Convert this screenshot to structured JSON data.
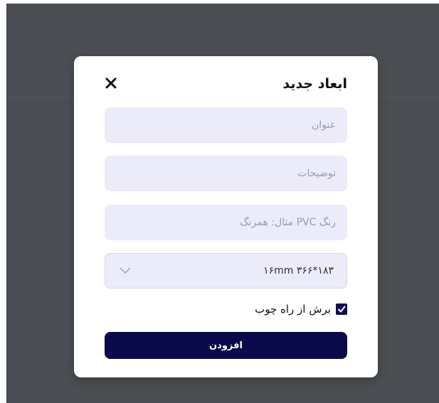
{
  "modal": {
    "title": "ابعاد جدید",
    "close_icon": "close-icon",
    "fields": {
      "title_placeholder": "عنوان",
      "description_placeholder": "توضیحات",
      "pvc_color_placeholder": "رنگ PVC مثال: همرنگ"
    },
    "dimension_select": {
      "selected": "۱۶mm ۳۶۶*۱۸۳",
      "icon": "chevron-down-icon"
    },
    "checkbox": {
      "label": "برش از راه چوب",
      "checked": true
    },
    "submit_label": "افزودن"
  },
  "colors": {
    "overlay": "#4b4e52",
    "field_bg": "#ebebfa",
    "primary": "#0b0a4a"
  }
}
